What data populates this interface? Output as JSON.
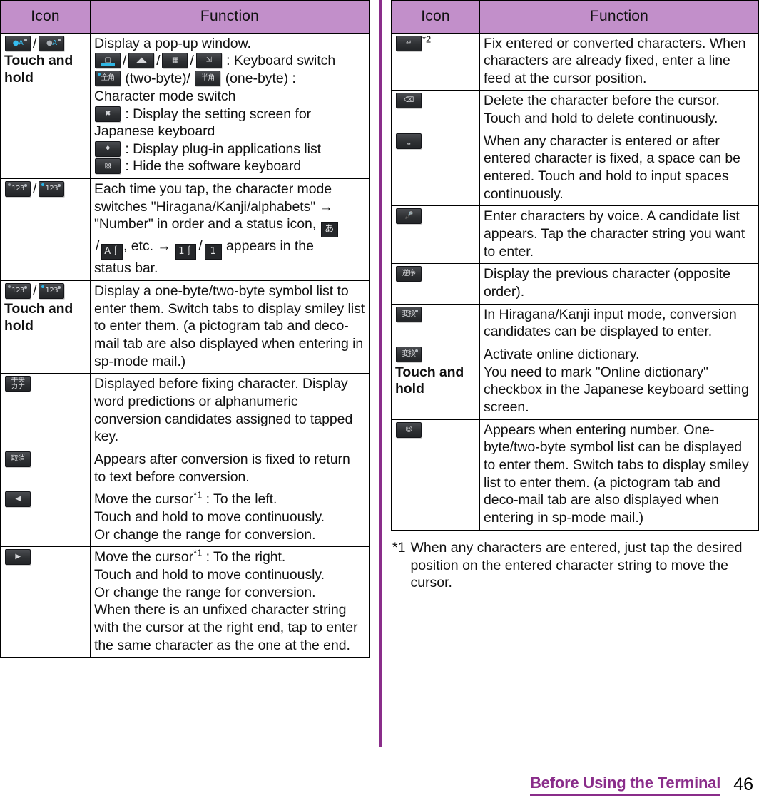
{
  "tables": {
    "left": {
      "headers": {
        "icon": "Icon",
        "function": "Function"
      },
      "rows": [
        {
          "icon_note": "Touch and hold",
          "function_lines": [
            "Display a pop-up window.",
            ": Keyboard switch",
            "(two-byte)/",
            "(one-byte) :",
            "Character mode switch",
            ": Display the setting screen for",
            "Japanese keyboard",
            ": Display plug-in applications list",
            ": Hide the software keyboard"
          ]
        },
        {
          "icon_note": "",
          "function_lines": [
            "Each time you tap, the character mode",
            "switches \"Hiragana/Kanji/alphabets\" →",
            "\"Number\" in order and a status icon,",
            ", etc. →",
            "appears in the",
            "status bar."
          ]
        },
        {
          "icon_note": "Touch and hold",
          "function_lines": [
            "Display a one-byte/two-byte symbol list to enter them. Switch tabs to display smiley list to enter them. (a pictogram tab and deco-mail tab are also displayed when entering in sp-mode mail.)"
          ]
        },
        {
          "icon_note": "",
          "function_lines": [
            "Displayed before fixing character. Display word predictions or alphanumeric conversion candidates assigned to tapped key."
          ]
        },
        {
          "icon_note": "",
          "function_lines": [
            "Appears after conversion is fixed to return to text before conversion."
          ]
        },
        {
          "icon_note": "",
          "function_lines": [
            "Move the cursor",
            ": To the left.",
            "Touch and hold to move continuously.",
            "Or change the range for conversion."
          ]
        },
        {
          "icon_note": "",
          "function_lines": [
            "Move the cursor",
            ": To the right.",
            "Touch and hold to move continuously.",
            "Or change the range for conversion.",
            "When there is an unfixed character string with the cursor at the right end, tap to enter the same character as the one at the end."
          ]
        }
      ]
    },
    "right": {
      "headers": {
        "icon": "Icon",
        "function": "Function"
      },
      "rows": [
        {
          "icon_note": "",
          "footnote_marker": "*2",
          "function_lines": [
            "Fix entered or converted characters. When characters are already fixed, enter a line feed at the cursor position."
          ]
        },
        {
          "icon_note": "",
          "function_lines": [
            "Delete the character before the cursor. Touch and hold to delete continuously."
          ]
        },
        {
          "icon_note": "",
          "function_lines": [
            "When any character is entered or after entered character is fixed, a space can be entered. Touch and hold to input spaces continuously."
          ]
        },
        {
          "icon_note": "",
          "function_lines": [
            "Enter characters by voice. A candidate list appears. Tap the character string you want to enter."
          ]
        },
        {
          "icon_note": "",
          "function_lines": [
            "Display the previous character (opposite order)."
          ]
        },
        {
          "icon_note": "",
          "function_lines": [
            "In Hiragana/Kanji input mode, conversion candidates can be displayed to enter."
          ]
        },
        {
          "icon_note": "Touch and hold",
          "function_lines": [
            "Activate online dictionary.",
            "You need to mark \"Online dictionary\" checkbox in the Japanese keyboard setting screen."
          ]
        },
        {
          "icon_note": "",
          "function_lines": [
            "Appears when entering number. One-byte/two-byte symbol list can be displayed to enter them. Switch tabs to display smiley list to enter them. (a pictogram tab and deco-mail tab are also displayed when entering in sp-mode mail.)"
          ]
        }
      ]
    }
  },
  "footnote": {
    "marker": "*1",
    "text": "When any characters are entered, just tap the desired position on the entered character string to move the cursor."
  },
  "footer": {
    "section": "Before Using the Terminal",
    "page": "46"
  },
  "icons": {
    "keyboard_mode_blue": "keyboard-mode-blue-icon",
    "keyboard_mode_gray": "keyboard-mode-gray-icon",
    "keyboard_switch_handwrite": "keyboard-switch-handwriting-icon",
    "keyboard_switch_10key": "keyboard-switch-10key-icon",
    "keyboard_switch_qwerty": "keyboard-switch-qwerty-icon",
    "keyboard_switch_other": "keyboard-switch-other-icon",
    "fullwidth": "fullwidth-zenkaku-icon",
    "halfwidth": "halfwidth-hankaku-icon",
    "settings_wrench": "settings-wrench-icon",
    "plugin": "plugin-applications-icon",
    "hide_keyboard": "hide-keyboard-icon",
    "num123_gray": "number-mode-gray-icon",
    "num123_blue": "number-mode-blue-icon",
    "status_hiragana": "status-hiragana-icon",
    "status_alpha": "status-alphabet-icon",
    "status_num_full": "status-number-fullwidth-icon",
    "status_num_half": "status-number-halfwidth-icon",
    "kana_katakana": "kana-katakana-conversion-icon",
    "undo_conversion": "undo-conversion-icon",
    "cursor_left": "cursor-left-icon",
    "cursor_right": "cursor-right-icon",
    "enter_key": "enter-return-icon",
    "backspace": "backspace-icon",
    "space": "space-bar-icon",
    "voice": "voice-input-microphone-icon",
    "reverse_order": "reverse-order-icon",
    "conversion": "conversion-candidates-icon",
    "online_dictionary": "online-dictionary-icon",
    "symbol_smiley": "symbol-smiley-list-icon"
  },
  "colors": {
    "header_purple": "#c28fca",
    "accent_purple": "#8a2d8a",
    "border": "#000000"
  }
}
